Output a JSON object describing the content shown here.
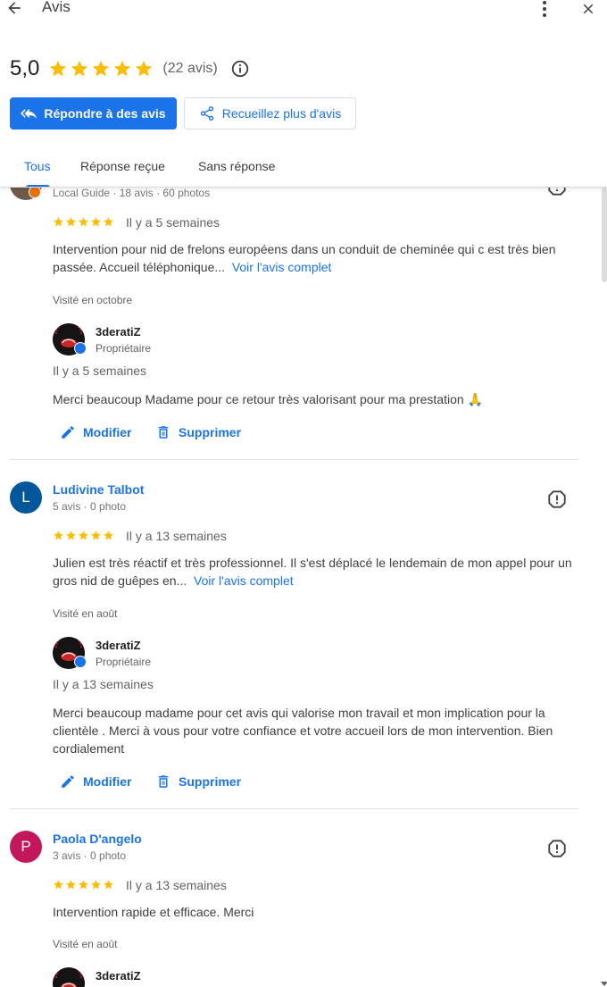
{
  "header": {
    "title": "Avis"
  },
  "summary": {
    "rating": "5,0",
    "stars": 5,
    "count": "(22 avis)"
  },
  "buttons": {
    "reply": "Répondre à des avis",
    "collect": "Recueillez plus d'avis"
  },
  "tabs": [
    {
      "label": "Tous",
      "active": true
    },
    {
      "label": "Réponse reçue",
      "active": false
    },
    {
      "label": "Sans réponse",
      "active": false
    }
  ],
  "colors": {
    "accent": "#1a73e8",
    "star": "#fbbc04"
  },
  "actions": {
    "edit": "Modifier",
    "delete": "Supprimer"
  },
  "reviews": [
    {
      "name": "",
      "meta": "Local Guide · 18 avis · 60 photos",
      "rating": 5,
      "when": "Il y a 5 semaines",
      "text": "Intervention pour nid de frelons européens dans un conduit de cheminée qui c est très bien passée. Accueil téléphonique...",
      "more": "Voir l'avis complet",
      "visited": "Visité en octobre",
      "reply": {
        "owner": "3deratiZ",
        "role": "Propriétaire",
        "when": "Il y a 5 semaines",
        "text": "Merci beaucoup Madame pour ce retour très valorisant pour ma prestation 🙏"
      }
    },
    {
      "name": "Ludivine Talbot",
      "initial": "L",
      "avatar_color": "#01579b",
      "meta": "5 avis · 0 photo",
      "rating": 5,
      "when": "Il y a 13 semaines",
      "text": "Julien est très réactif et très professionnel. Il s'est déplacé le lendemain de mon appel pour un gros nid de guêpes en...",
      "more": "Voir l'avis complet",
      "visited": "Visité en août",
      "reply": {
        "owner": "3deratiZ",
        "role": "Propriétaire",
        "when": "Il y a 13 semaines",
        "text": "Merci beaucoup madame pour cet avis qui valorise mon travail et mon implication pour la clientèle . Merci à vous pour votre confiance et votre accueil lors de mon intervention. Bien cordialement"
      }
    },
    {
      "name": "Paola D'angelo",
      "initial": "P",
      "avatar_color": "#c2185b",
      "meta": "3 avis · 0 photo",
      "rating": 5,
      "when": "Il y a 13 semaines",
      "text": "Intervention rapide et efficace. Merci",
      "visited": "Visité en août",
      "reply": {
        "owner": "3deratiZ"
      }
    }
  ]
}
